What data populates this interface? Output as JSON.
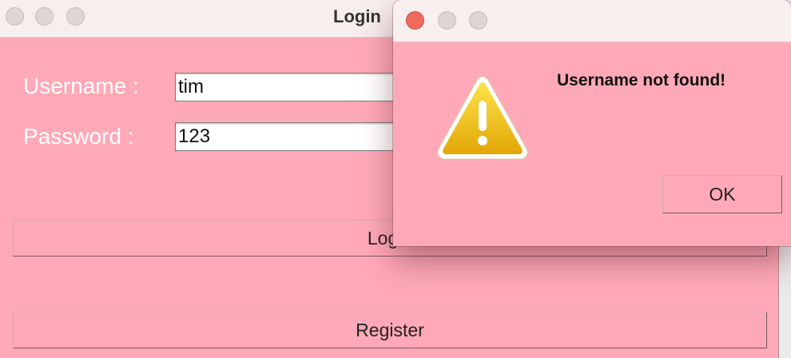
{
  "main_window": {
    "title": "Login",
    "username_label": "Username :",
    "username_value": "tim",
    "password_label": "Password :",
    "password_value": "123",
    "login_button": "Login",
    "register_button": "Register"
  },
  "alert": {
    "message": "Username not found!",
    "ok_button": "OK",
    "icon": "warning-icon"
  },
  "colors": {
    "window_bg": "#ffa9b8",
    "titlebar_bg": "#f7eeee",
    "close_button": "#ee6a5e",
    "warning_yellow": "#f2c40c"
  }
}
